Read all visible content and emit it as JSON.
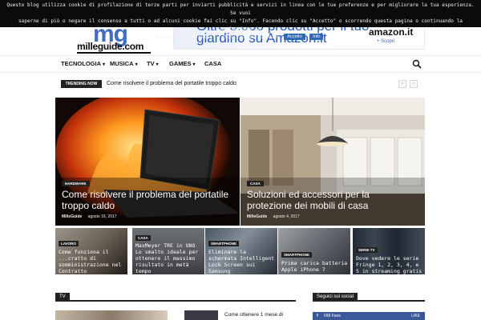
{
  "cookie": {
    "line1": "Questo blog utilizza cookie di profilazione di terze parti per inviarti pubblicità e servizi in linea con le tue preferenze e per migliorare la tua esperienza. Se vuoi",
    "line2": "saperne di più o negare il consenso a tutti o ad alcuni cookie fai clic su \"Info\". Facendo clic su \"Accetto\" o scorrendo questa pagina o continuando la navigazione in",
    "line3_pre": "altro modo, accetti l'utilizzo dei cookie.",
    "accept": "Accetto",
    "info": "Info"
  },
  "logo": {
    "mark": "mg",
    "text": "milleguide.com"
  },
  "banner": {
    "text1": "Oltre 3.000 prodotti per il tuo",
    "text2": "giardino su Amazon.it",
    "brand": "amazon.it",
    "brand_sub": "+ Scopri"
  },
  "nav": {
    "items": [
      {
        "label": "TECNOLOGIA",
        "caret": "▾"
      },
      {
        "label": "MUSICA",
        "caret": "▾"
      },
      {
        "label": "TV",
        "caret": "▾"
      },
      {
        "label": "GAMES",
        "caret": "▾"
      },
      {
        "label": "CASA",
        "caret": ""
      }
    ]
  },
  "trending": {
    "label": "TRENDING NOW",
    "text": "Come risolvere il problema del portatile troppo caldo",
    "prev": "‹",
    "next": "›"
  },
  "features": [
    {
      "tag": "HARDWARE",
      "title": "Come risolvere il problema del portatile troppo caldo",
      "author": "MilleGuide",
      "date": "agosto 16, 2017"
    },
    {
      "tag": "CASA",
      "title": "Soluzioni ed accessori per la protezione dei mobili di casa",
      "author": "MilleGuide",
      "date": "agosto 4, 2017"
    }
  ],
  "small_posts": [
    {
      "tag": "LAVORO",
      "title": "Come funziona il ...cratto di somministrazione nel Contratto Metalmeccanico?"
    },
    {
      "tag": "CASA",
      "title": "MaxMeyer TRE in UNO Lo smalto ideale per ottenere il massimo risultato in metà tempo"
    },
    {
      "tag": "SMARTPHONE",
      "title": "Eliminare la schermata Intelligent Lock Screen sui Samsung"
    },
    {
      "tag": "SMARTPHONE",
      "title": "Prima carica batteria Apple iPhone 7"
    },
    {
      "tag": "SERIE TV",
      "title": "Dove vedere le serie Fringe 1, 2, 3, 4, e 5 in streaming gratis"
    }
  ],
  "sections": {
    "tv": "TV",
    "social": "Seguici sui social"
  },
  "tv_post": {
    "title": "Come ottenere 1 mese di"
  },
  "facebook": {
    "fans": "699 Fans",
    "like": "LIKE"
  }
}
